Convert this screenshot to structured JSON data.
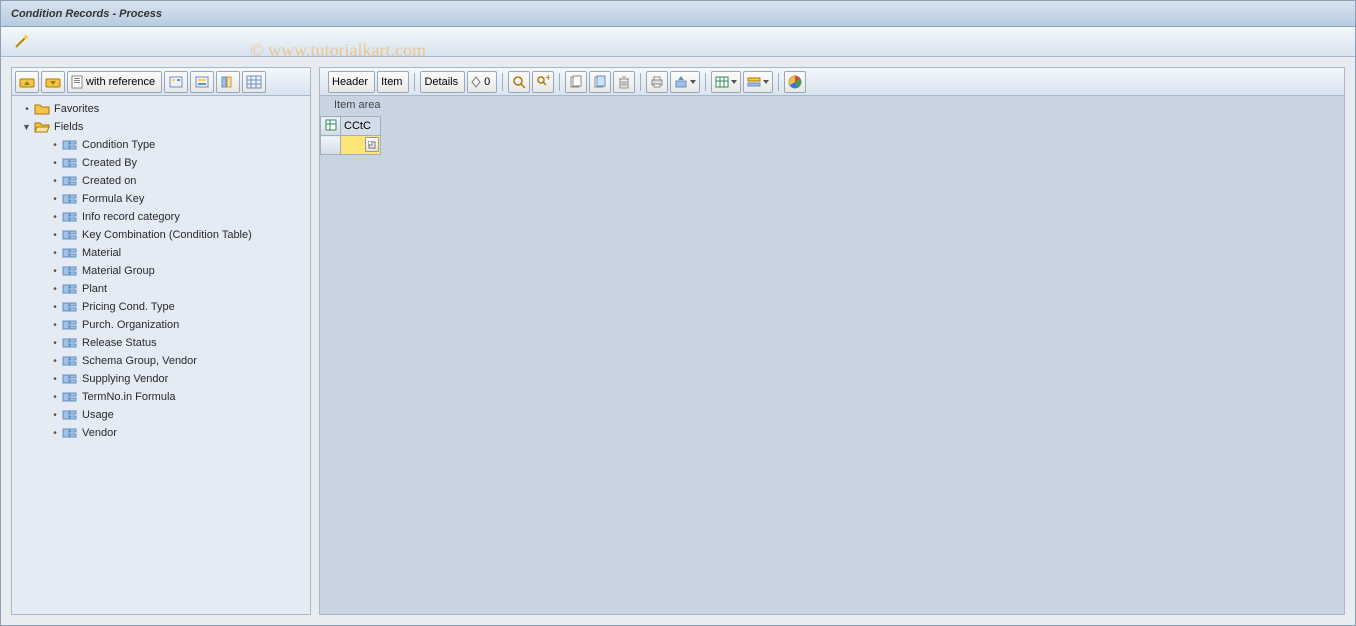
{
  "window": {
    "title": "Condition Records - Process"
  },
  "watermark": "© www.tutorialkart.com",
  "left_toolbar": {
    "btn1_icon": "collapse-icon",
    "btn2_icon": "expand-icon",
    "btn_ref_label": "with reference",
    "btn_icons": [
      "select-layout-icon",
      "change-layout-icon",
      "column-icon",
      "grid-icon"
    ]
  },
  "tree": {
    "favorites": "Favorites",
    "fields": "Fields",
    "field_items": [
      "Condition Type",
      "Created By",
      "Created on",
      "Formula Key",
      "Info record category",
      "Key Combination (Condition Table)",
      "Material",
      "Material Group",
      "Plant",
      "Pricing Cond. Type",
      "Purch. Organization",
      "Release Status",
      "Schema Group, Vendor",
      "Supplying Vendor",
      "TermNo.in Formula",
      "Usage",
      "Vendor"
    ]
  },
  "right_toolbar": {
    "header_label": "Header",
    "item_label": "Item",
    "details_label": "Details",
    "nav_label": "0"
  },
  "item_area": {
    "label": "Item area",
    "column_header": "CCtC"
  }
}
